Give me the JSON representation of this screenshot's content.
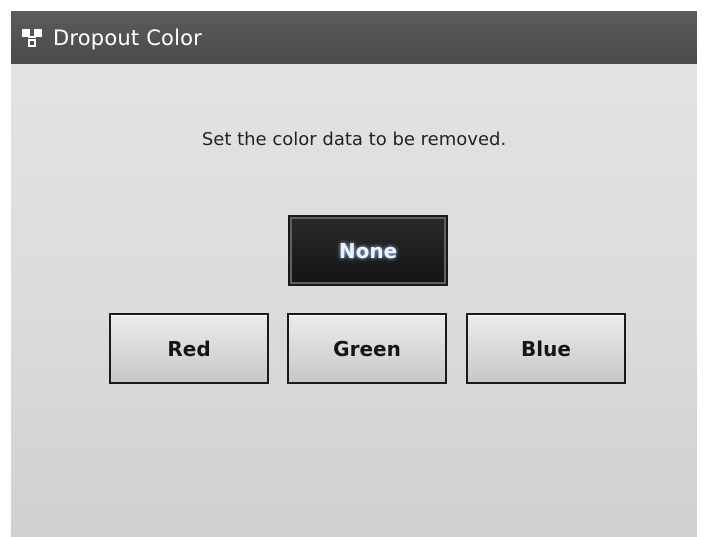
{
  "header": {
    "title": "Dropout Color",
    "icon": "network-icon"
  },
  "main": {
    "instruction": "Set the color data to be removed.",
    "options": {
      "none": "None",
      "red": "Red",
      "green": "Green",
      "blue": "Blue"
    },
    "selected": "None"
  },
  "colors": {
    "header_bg": "#505050",
    "screen_bg": "#dcdcdc",
    "selected_bg": "#1e1e1e",
    "selected_text": "#eaf2ff",
    "button_bg": "#dadada"
  }
}
